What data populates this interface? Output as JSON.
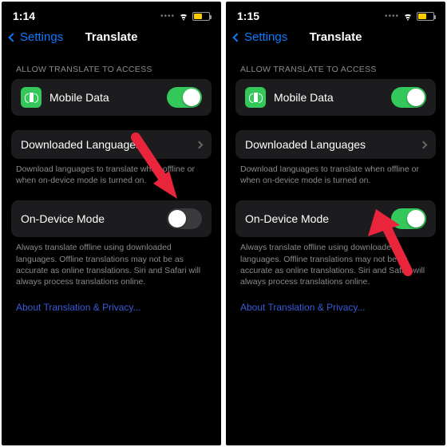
{
  "screens": [
    {
      "statusbar": {
        "time": "1:14",
        "battery_pct": 48,
        "battery_color": "#ffcc00"
      },
      "nav": {
        "back": "Settings",
        "title": "Translate"
      },
      "allow_header": "ALLOW TRANSLATE TO ACCESS",
      "mobile_data": {
        "label": "Mobile Data",
        "on": true
      },
      "downloaded": {
        "label": "Downloaded Languages"
      },
      "downloaded_note": "Download languages to translate when offline or when on-device mode is turned on.",
      "ondevice": {
        "label": "On-Device Mode",
        "on": false
      },
      "ondevice_note": "Always translate offline using downloaded languages. Offline translations may not be as accurate as online translations. Siri and Safari will always process translations online.",
      "about_link": "About Translation & Privacy..."
    },
    {
      "statusbar": {
        "time": "1:15",
        "battery_pct": 48,
        "battery_color": "#ffcc00"
      },
      "nav": {
        "back": "Settings",
        "title": "Translate"
      },
      "allow_header": "ALLOW TRANSLATE TO ACCESS",
      "mobile_data": {
        "label": "Mobile Data",
        "on": true
      },
      "downloaded": {
        "label": "Downloaded Languages"
      },
      "downloaded_note": "Download languages to translate when offline or when on-device mode is turned on.",
      "ondevice": {
        "label": "On-Device Mode",
        "on": true
      },
      "ondevice_note": "Always translate offline using downloaded languages. Offline translations may not be as accurate as online translations. Siri and Safari will always process translations online.",
      "about_link": "About Translation & Privacy..."
    }
  ],
  "colors": {
    "accent_blue": "#0a7aff",
    "link_blue": "#3b5bdb",
    "green": "#34c759"
  }
}
